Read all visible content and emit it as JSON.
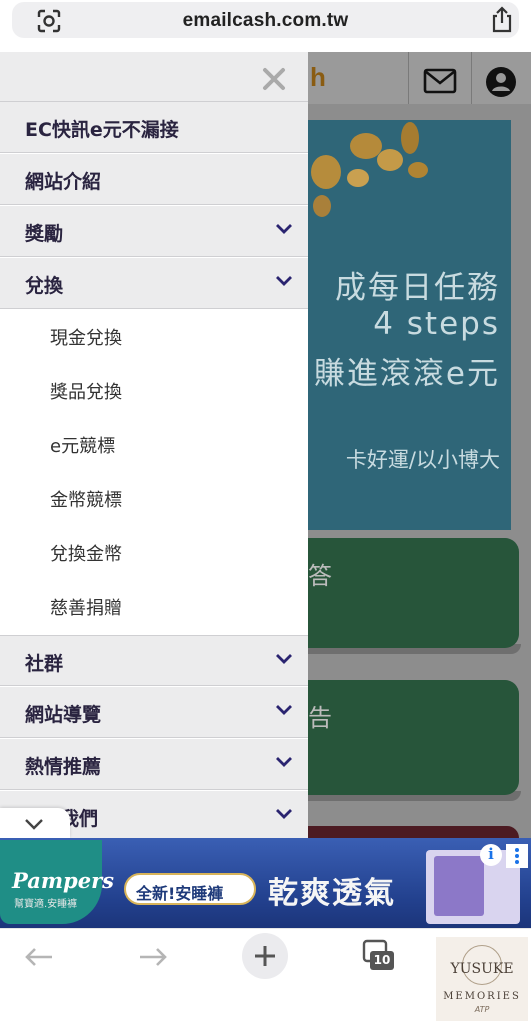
{
  "browser": {
    "url": "emailcash.com.tw",
    "icons": {
      "left": "lens-scan-icon",
      "right": "share-icon"
    }
  },
  "site": {
    "logo_fragment": "h",
    "header_icons": [
      "mail-icon",
      "account-icon"
    ],
    "banner": {
      "line1": "成每日任務",
      "line2": "4 steps",
      "line3": "賺進滾滾e元",
      "line4": "卡好運/以小博大"
    },
    "cards": [
      "答",
      "告"
    ]
  },
  "drawer": {
    "close_icon": "close-icon",
    "items": [
      {
        "label": "EC快訊e元不漏接",
        "expandable": false
      },
      {
        "label": "網站介紹",
        "expandable": false
      },
      {
        "label": "獎勵",
        "expandable": true
      },
      {
        "label": "兌換",
        "expandable": true
      }
    ],
    "sub_items": [
      "現金兌換",
      "獎品兌換",
      "e元競標",
      "金幣競標",
      "兌換金幣",
      "慈善捐贈"
    ],
    "bottom_items": [
      {
        "label": "社群",
        "expandable": true
      },
      {
        "label": "網站導覽",
        "expandable": true
      },
      {
        "label": "熱情推薦",
        "expandable": true
      },
      {
        "label": "我們",
        "expandable": true
      }
    ]
  },
  "ad": {
    "brand": "Pampers",
    "brand_sub": "幫寶適.安睡褲",
    "pill": "全新!安睡褲",
    "headline": "乾爽透氣",
    "info_icon": "info-icon",
    "menu_icon": "kebab-menu-icon"
  },
  "toolbar": {
    "tab_count": "10"
  },
  "watermark": {
    "line1": "YUSUKE",
    "line2": "MEMORIES",
    "line3": "ATP"
  }
}
